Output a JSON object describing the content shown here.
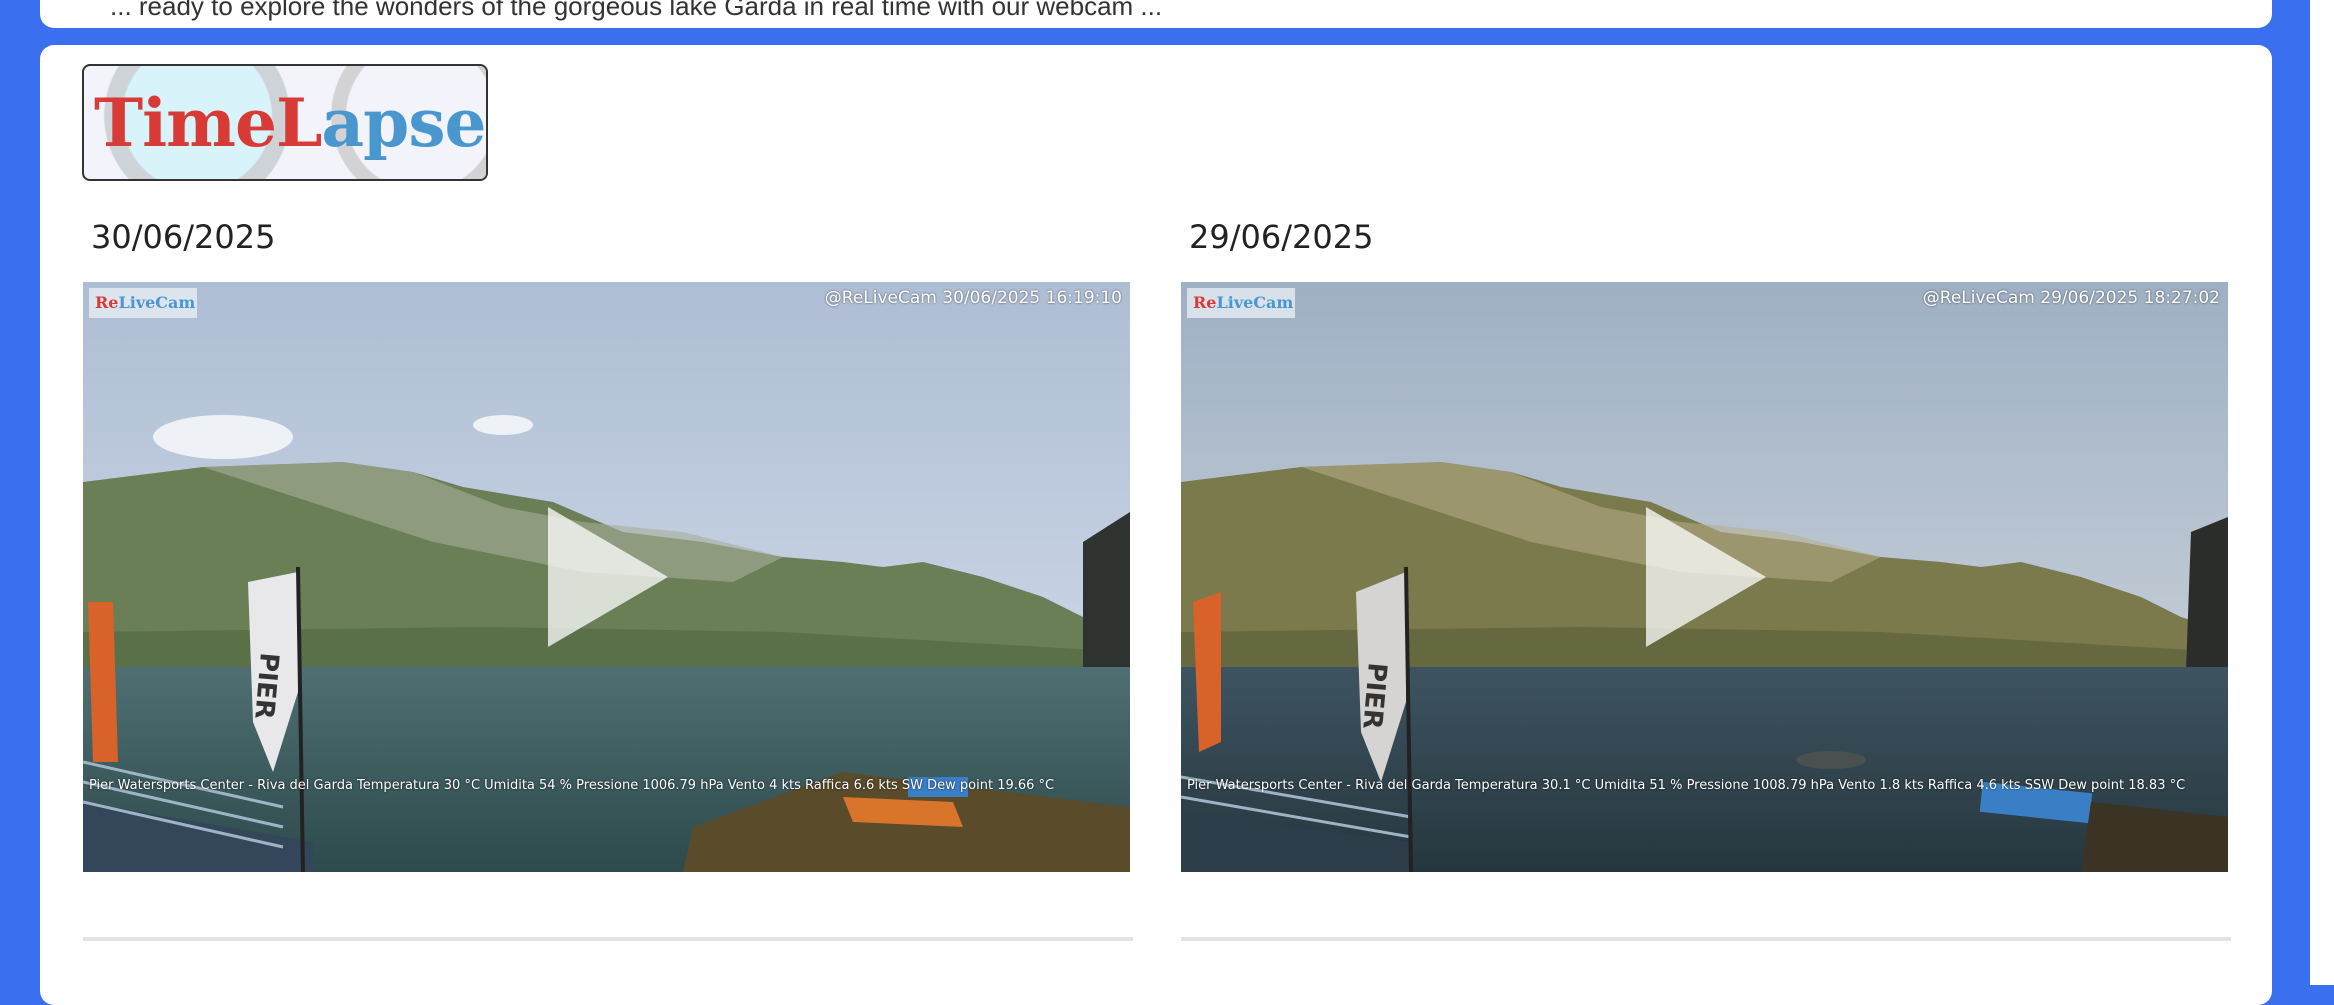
{
  "top_card": {
    "text": "... ready to explore the wonders of the gorgeous lake Garda in real time with our webcam ..."
  },
  "logo": {
    "part1": "Time",
    "part2": "L",
    "part3": "apse"
  },
  "videos": [
    {
      "date": "30/06/2025",
      "cam_logo": {
        "a": "Re",
        "b": "LiveCam"
      },
      "stamp": "@ReLiveCam 30/06/2025 16:19:10",
      "weather": "Pier Watersports Center - Riva del Garda Temperatura 30 °C  Umidita 54 %  Pressione 1006.79 hPa Vento 4 kts Raffica 6.6 kts SW Dew point 19.66 °C",
      "flag_text": "PIER"
    },
    {
      "date": "29/06/2025",
      "cam_logo": {
        "a": "Re",
        "b": "LiveCam"
      },
      "stamp": "@ReLiveCam 29/06/2025 18:27:02",
      "weather": "Pier Watersports Center - Riva del Garda Temperatura 30.1 °C  Umidita 51 %  Pressione 1008.79 hPa Vento 1.8 kts Raffica 4.6 kts SSW Dew point 18.83 °C",
      "flag_text": "PIER"
    }
  ],
  "colors": {
    "page_bg": "#3a6ff0",
    "card_bg": "#ffffff",
    "logo_red": "#d83b35",
    "logo_blue": "#4a97cf"
  }
}
